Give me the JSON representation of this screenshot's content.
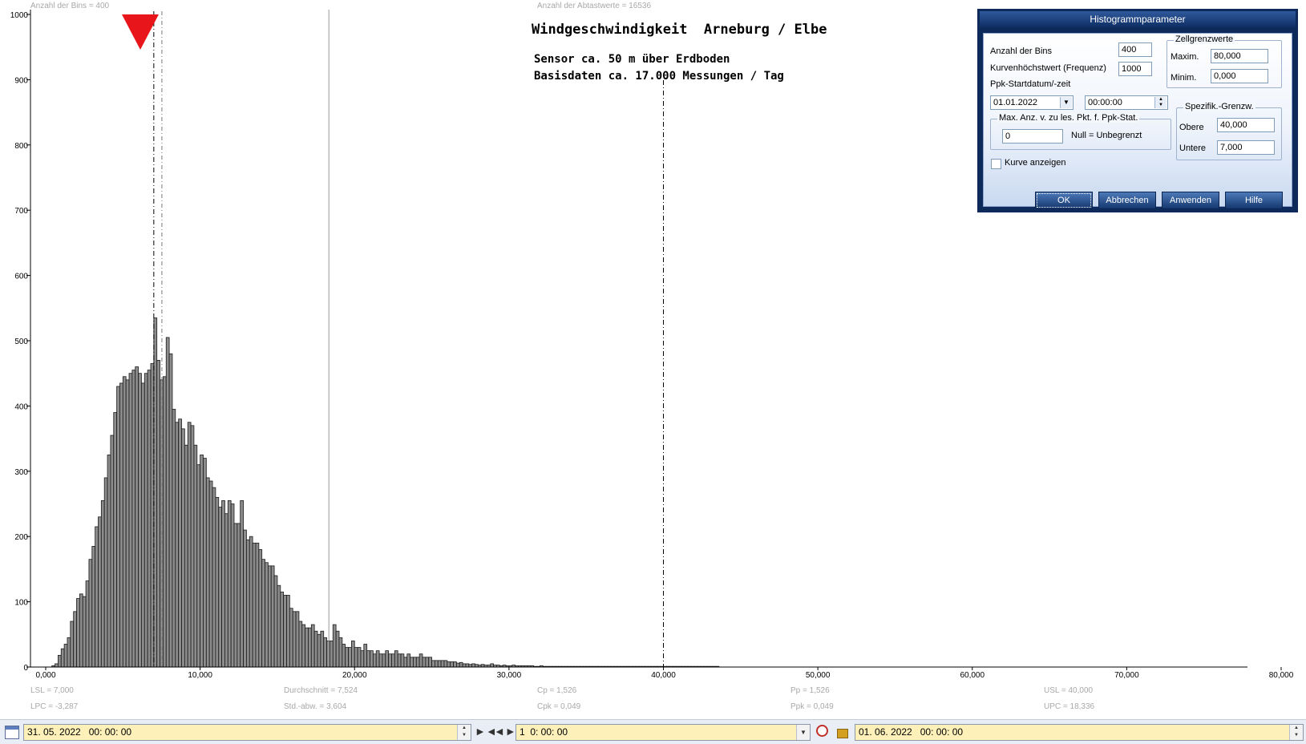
{
  "chart_data": {
    "type": "bar",
    "title": "Windgeschwindigkeit  Arneburg / Elbe",
    "subtitle_lines": [
      "Sensor ca. 50 m über Erdboden",
      "Basisdaten ca. 17.000 Messungen / Tag"
    ],
    "xlim": [
      0,
      80
    ],
    "ylim": [
      0,
      1000
    ],
    "x_tick_labels": [
      "0,000",
      "10,000",
      "20,000",
      "30,000",
      "40,000",
      "50,000",
      "60,000",
      "70,000",
      "80,000"
    ],
    "y_tick_labels": [
      "0",
      "100",
      "200",
      "300",
      "400",
      "500",
      "600",
      "700",
      "800",
      "900",
      "1000"
    ],
    "bin_width": 0.2,
    "bin_start": 0,
    "values": [
      0,
      0,
      2,
      5,
      18,
      28,
      35,
      45,
      70,
      85,
      105,
      112,
      108,
      132,
      165,
      185,
      215,
      230,
      255,
      290,
      325,
      355,
      390,
      430,
      435,
      445,
      440,
      450,
      455,
      460,
      450,
      435,
      450,
      455,
      465,
      535,
      470,
      440,
      445,
      505,
      480,
      395,
      375,
      380,
      365,
      340,
      375,
      370,
      340,
      310,
      325,
      320,
      290,
      285,
      275,
      260,
      245,
      255,
      235,
      255,
      250,
      220,
      220,
      255,
      210,
      195,
      200,
      190,
      190,
      180,
      165,
      160,
      155,
      155,
      140,
      125,
      115,
      110,
      110,
      90,
      85,
      85,
      70,
      65,
      60,
      60,
      65,
      55,
      50,
      55,
      45,
      40,
      40,
      65,
      55,
      45,
      35,
      30,
      30,
      40,
      30,
      30,
      25,
      35,
      25,
      25,
      20,
      25,
      20,
      20,
      25,
      20,
      20,
      25,
      20,
      20,
      15,
      20,
      15,
      15,
      15,
      20,
      15,
      15,
      15,
      10,
      10,
      10,
      10,
      10,
      8,
      8,
      8,
      6,
      7,
      5,
      5,
      4,
      5,
      4,
      3,
      4,
      3,
      3,
      5,
      3,
      3,
      2,
      3,
      2,
      2,
      3,
      2,
      2,
      2,
      2,
      2,
      2,
      1,
      1,
      2,
      1,
      1,
      1,
      1,
      1,
      1,
      1,
      1,
      1,
      1,
      1,
      1,
      1,
      1,
      1,
      1,
      1,
      1,
      1,
      1,
      1,
      1,
      1,
      1,
      1,
      1,
      1,
      1,
      1,
      1,
      1,
      1,
      1,
      1,
      1,
      1,
      1,
      1,
      1,
      1,
      1,
      1,
      1,
      1,
      1,
      1,
      1,
      1,
      1,
      1,
      1,
      1,
      1,
      1,
      1,
      1,
      1
    ],
    "reference_lines": {
      "LSL": 7.0,
      "mean": 7.524,
      "UPC": 18.336,
      "USL": 40.0
    },
    "marker_label": "LSL"
  },
  "plot_labels": {
    "bins_label": "Anzahl der Bins =    400",
    "samples_label": "Anzahl der Abtastwerte = 16536"
  },
  "stats": {
    "lsl": "LSL = 7,000",
    "lpc": "LPC = -3,287",
    "mean": "Durchschnitt  = 7,524",
    "std": "Std.-abw. = 3,604",
    "cp": "Cp  = 1,526",
    "cpk": "Cpk = 0,049",
    "pp": "Pp  = 1,526",
    "ppk": "Ppk = 0,049",
    "usl": "USL = 40,000",
    "upc": "UPC = 18,336"
  },
  "dialog": {
    "title": "Histogrammparameter",
    "bins_label": "Anzahl der Bins",
    "bins_value": "400",
    "curvemax_label": "Kurvenhöchstwert (Frequenz)",
    "curvemax_value": "1000",
    "ppk_start_label": "Ppk-Startdatum/-zeit",
    "start_date": "01.01.2022",
    "start_time": "00:00:00",
    "max_group_label": "Max. Anz. v. zu les. Pkt. f. Ppk-Stat.",
    "max_value": "0",
    "null_label": "Null = Unbegrenzt",
    "show_curve_label": "Kurve anzeigen",
    "cell_group_label": "Zellgrenzwerte",
    "max_label": "Maxim.",
    "max_cell_value": "80,000",
    "min_label": "Minim.",
    "min_cell_value": "0,000",
    "spec_group_label": "Spezifik.-Grenzw.",
    "upper_label": "Obere",
    "upper_value": "40,000",
    "lower_label": "Untere",
    "lower_value": "7,000",
    "ok": "OK",
    "cancel": "Abbrechen",
    "apply": "Anwenden",
    "help": "Hilfe"
  },
  "toolbar": {
    "start": "31. 05. 2022   00: 00: 00",
    "interval": "1  0: 00: 00",
    "end": "01. 06. 2022   00: 00: 00"
  },
  "colors": {
    "bar_fill": "#8c8c8c",
    "marker": "#e8161b",
    "dialog_frame": "#0e2a5a",
    "toolbar_field": "#fdf1b9"
  }
}
